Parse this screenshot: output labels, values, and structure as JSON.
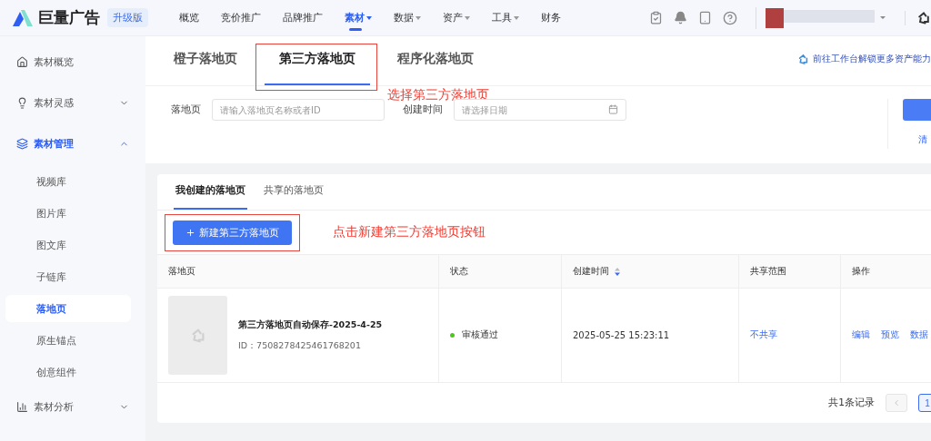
{
  "header": {
    "logo": "巨量广告",
    "badge": "升级版",
    "nav": [
      {
        "label": "概览",
        "selected": false,
        "dropdown": false
      },
      {
        "label": "竞价推广",
        "selected": false,
        "dropdown": false
      },
      {
        "label": "品牌推广",
        "selected": false,
        "dropdown": false
      },
      {
        "label": "素材",
        "selected": true,
        "dropdown": true
      },
      {
        "label": "数据",
        "selected": false,
        "dropdown": true
      },
      {
        "label": "资产",
        "selected": false,
        "dropdown": true
      },
      {
        "label": "工具",
        "selected": false,
        "dropdown": true
      },
      {
        "label": "财务",
        "selected": false,
        "dropdown": false
      }
    ]
  },
  "sidebar": {
    "items": [
      {
        "label": "素材概览",
        "kind": "home",
        "selected": false
      },
      {
        "label": "素材灵感",
        "kind": "bulb",
        "selected": false,
        "expanded": false
      },
      {
        "label": "素材管理",
        "kind": "layers",
        "selected": true,
        "expanded": true,
        "children": [
          {
            "label": "视频库",
            "selected": false
          },
          {
            "label": "图片库",
            "selected": false
          },
          {
            "label": "图文库",
            "selected": false
          },
          {
            "label": "子链库",
            "selected": false
          },
          {
            "label": "落地页",
            "selected": true
          },
          {
            "label": "原生锚点",
            "selected": false
          },
          {
            "label": "创意组件",
            "selected": false
          }
        ]
      },
      {
        "label": "素材分析",
        "kind": "chart",
        "selected": false,
        "expanded": false
      }
    ]
  },
  "page_tabs": [
    {
      "label": "橙子落地页",
      "selected": false
    },
    {
      "label": "第三方落地页",
      "selected": true
    },
    {
      "label": "程序化落地页",
      "selected": false
    }
  ],
  "promo_link": "前往工作台解锁更多资产能力",
  "filters": [
    {
      "label": "落地页",
      "placeholder": "请输入落地页名称或者ID",
      "kind": "text"
    },
    {
      "label": "创建时间",
      "placeholder": "请选择日期",
      "kind": "date"
    }
  ],
  "clear_link": "清",
  "list_tabs": [
    {
      "label": "我创建的落地页",
      "selected": true
    },
    {
      "label": "共享的落地页",
      "selected": false
    }
  ],
  "new_button": "新建第三方落地页",
  "annotations": [
    {
      "text": "选择第三方落地页"
    },
    {
      "text": "点击新建第三方落地页按钮"
    }
  ],
  "table": {
    "columns": [
      {
        "label": "落地页",
        "sortable": false
      },
      {
        "label": "状态",
        "sortable": false
      },
      {
        "label": "创建时间",
        "sortable": true
      },
      {
        "label": "共享范围",
        "sortable": false
      },
      {
        "label": "操作",
        "sortable": false
      }
    ],
    "rows": [
      {
        "name": "第三方落地页自动保存-2025-4-25",
        "id": "ID：7508278425461768201",
        "status": {
          "label": "审核通过",
          "color": "#52c41a"
        },
        "created": "2025-05-25 15:23:11",
        "share": "不共享",
        "actions": [
          "编辑",
          "预览",
          "数据"
        ]
      }
    ]
  },
  "pagination": {
    "total": "共1条记录",
    "pages": [
      {
        "label": "1",
        "selected": true
      }
    ]
  }
}
